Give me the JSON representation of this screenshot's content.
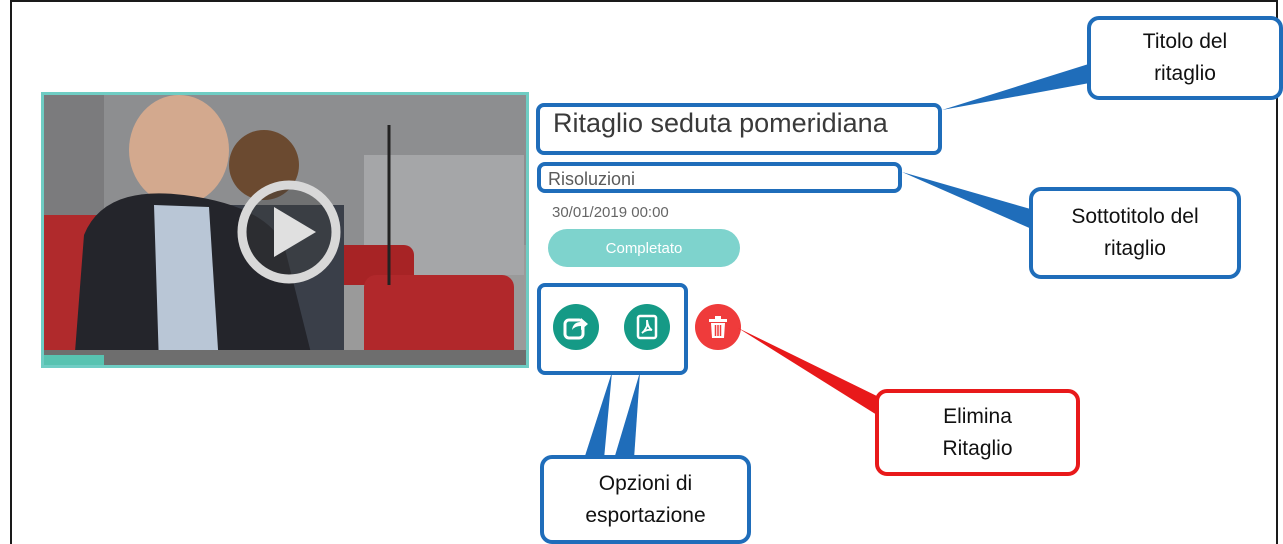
{
  "clip": {
    "title": "Ritaglio seduta pomeridiana",
    "subtitle": "Risoluzioni",
    "date": "30/01/2019 00:00",
    "status": "Completato"
  },
  "actions": {
    "export_icon": "share-export-icon",
    "pdf_icon": "pdf-icon",
    "delete_icon": "trash-icon"
  },
  "callouts": {
    "title": [
      "Titolo del",
      "ritaglio"
    ],
    "subtitle": [
      "Sottotitolo del",
      "ritaglio"
    ],
    "delete": [
      "Elimina",
      "Ritaglio"
    ],
    "export": [
      "Opzioni di",
      "esportazione"
    ]
  },
  "colors": {
    "accent": "#159a86",
    "status": "#7ed3cd",
    "delete": "#ef3b3b",
    "highlight_blue": "#1f6dba",
    "highlight_red": "#e8191a"
  }
}
